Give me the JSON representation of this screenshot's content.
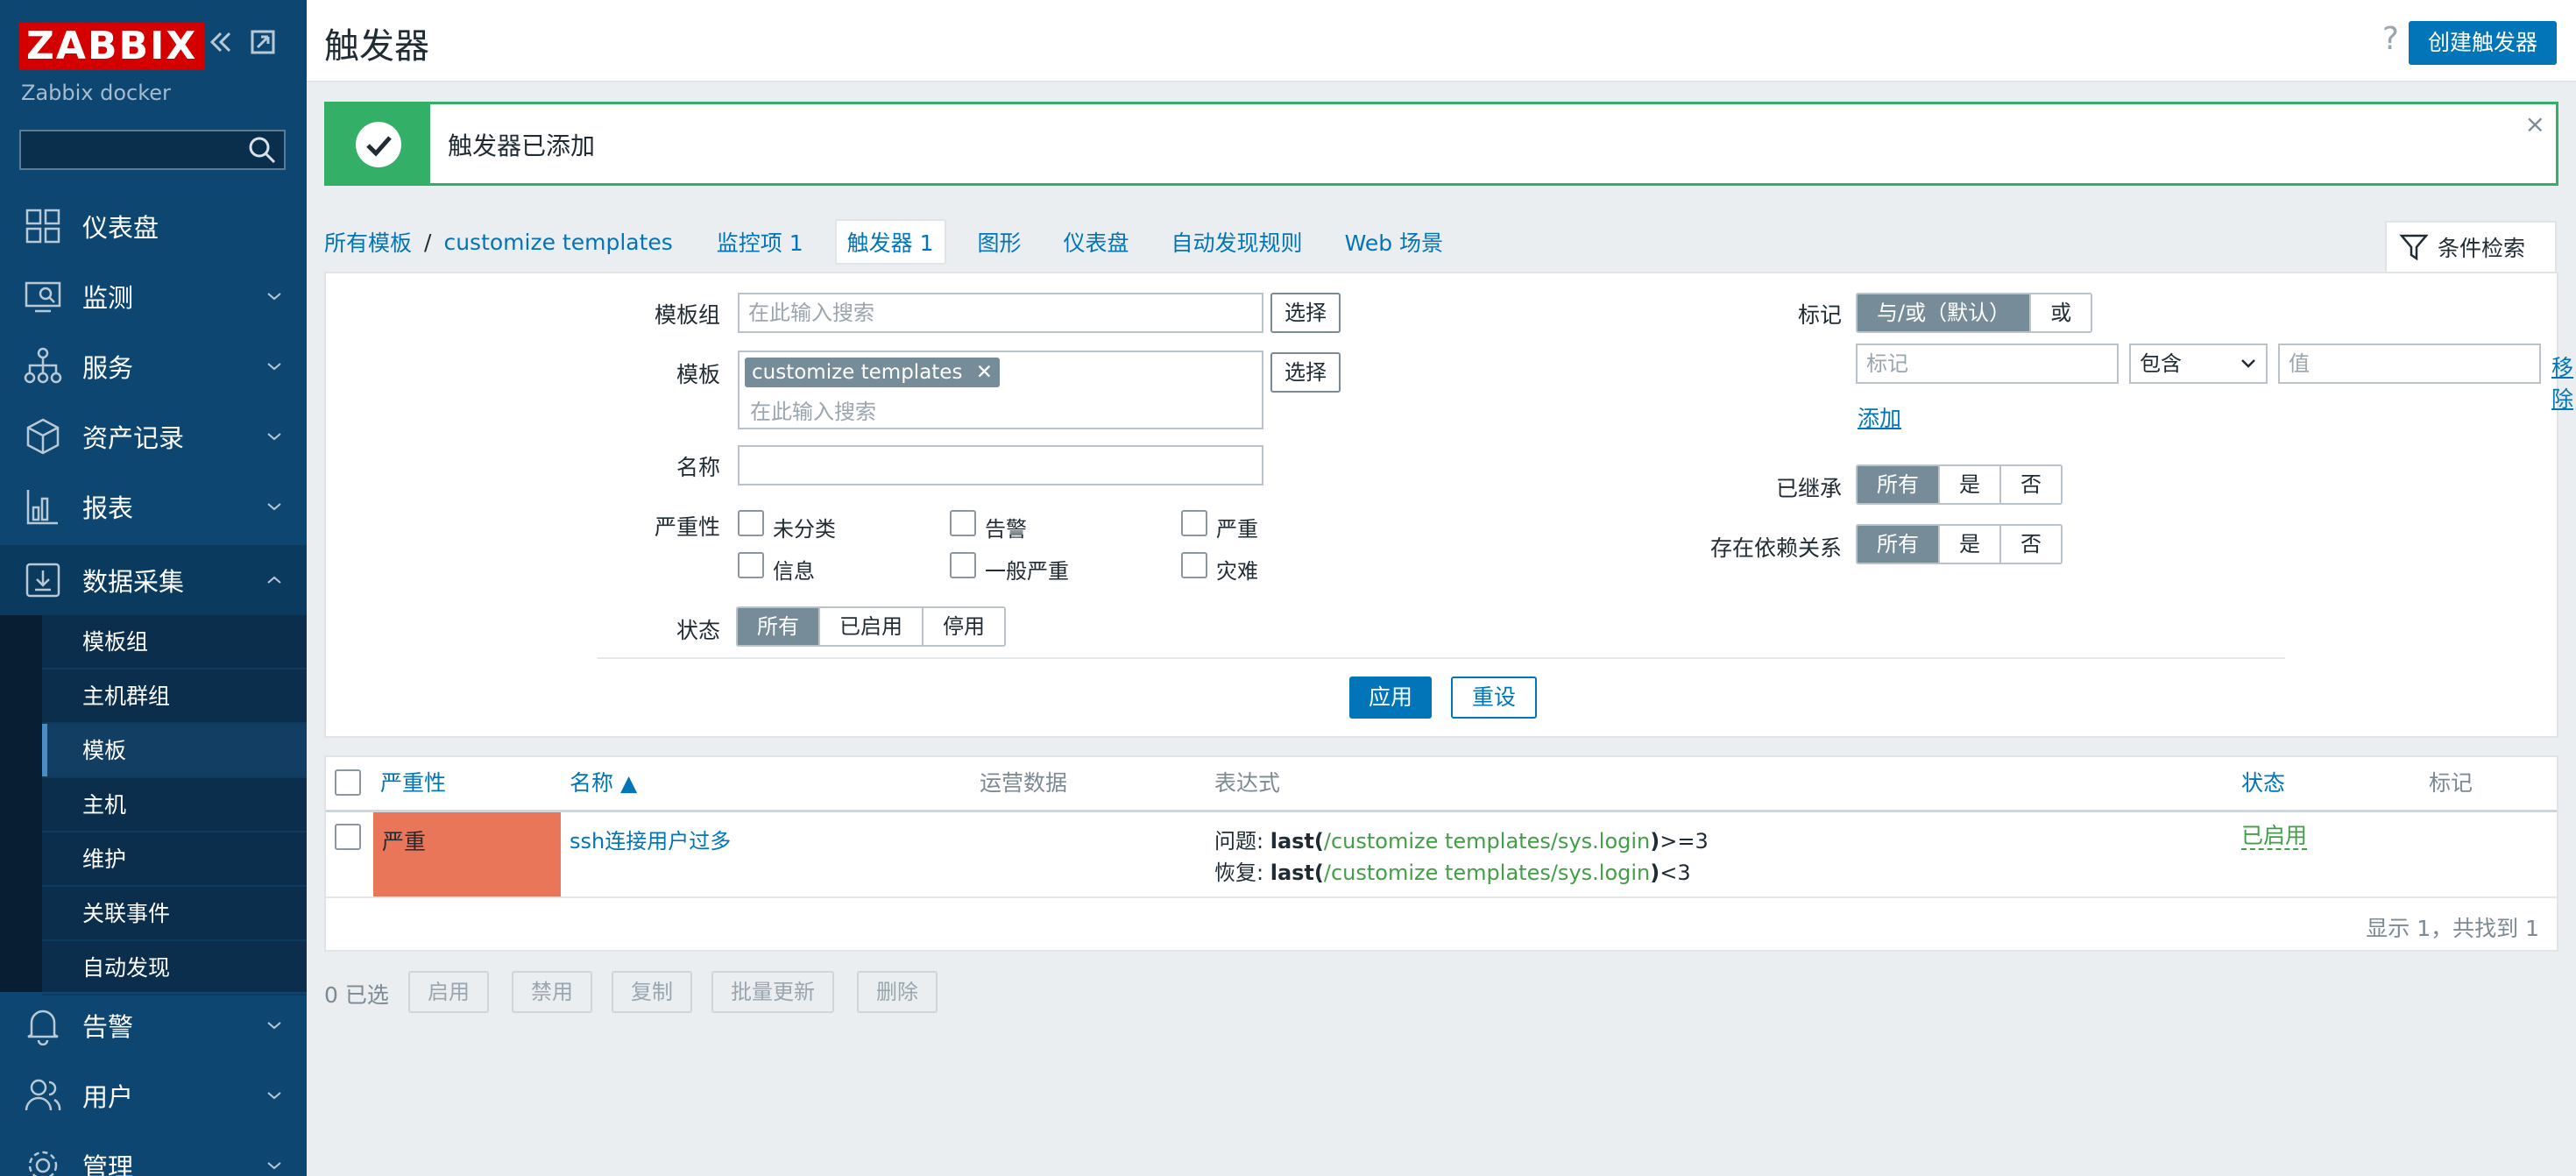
{
  "sidebar": {
    "logo": "ZABBIX",
    "collapse_icon": "double-chevron-left-icon",
    "kiosk_icon": "expand-icon",
    "server_name": "Zabbix docker",
    "search_placeholder": "",
    "menu": [
      {
        "label": "仪表盘",
        "icon": "dashboard-icon"
      },
      {
        "label": "监测",
        "icon": "monitoring-icon"
      },
      {
        "label": "服务",
        "icon": "services-icon"
      },
      {
        "label": "资产记录",
        "icon": "inventory-icon"
      },
      {
        "label": "报表",
        "icon": "reports-icon"
      },
      {
        "label": "数据采集",
        "icon": "data-collection-icon"
      },
      {
        "label": "告警",
        "icon": "bell-icon"
      },
      {
        "label": "用户",
        "icon": "users-icon"
      },
      {
        "label": "管理",
        "icon": "gear-icon"
      }
    ],
    "submenu": [
      "模板组",
      "主机群组",
      "模板",
      "主机",
      "维护",
      "关联事件",
      "自动发现"
    ],
    "active_submenu": "模板"
  },
  "header": {
    "title": "触发器",
    "help": "?",
    "create_button": "创建触发器"
  },
  "message": {
    "text": "触发器已添加",
    "close": "×"
  },
  "breadcrumb": {
    "all_templates": "所有模板",
    "sep": "/",
    "template": "customize templates"
  },
  "tabs": {
    "items": "监控项 1",
    "triggers": "触发器 1",
    "graphs": "图形",
    "dashboards": "仪表盘",
    "discovery": "自动发现规则",
    "web": "Web 场景"
  },
  "filter_tab": "条件检索",
  "filter": {
    "template_group_label": "模板组",
    "template_group_placeholder": "在此输入搜索",
    "select": "选择",
    "template_label": "模板",
    "template_chip": "customize templates",
    "chip_remove": "✕",
    "template_placeholder": "在此输入搜索",
    "name_label": "名称",
    "name_value": "",
    "severity_label": "严重性",
    "severities": [
      "未分类",
      "告警",
      "严重",
      "信息",
      "一般严重",
      "灾难"
    ],
    "state_label": "状态",
    "state_options": [
      "所有",
      "已启用",
      "停用"
    ],
    "tags_label": "标记",
    "tags_mode": [
      "与/或（默认）",
      "或"
    ],
    "tag_placeholder": "标记",
    "tag_operator": "包含",
    "tag_value_placeholder": "值",
    "remove": "移除",
    "add": "添加",
    "inherited_label": "已继承",
    "inherited_options": [
      "所有",
      "是",
      "否"
    ],
    "dependencies_label": "存在依赖关系",
    "dependencies_options": [
      "所有",
      "是",
      "否"
    ],
    "apply": "应用",
    "reset": "重设"
  },
  "table": {
    "columns": {
      "severity": "严重性",
      "name": "名称 ▲",
      "operational": "运营数据",
      "expression": "表达式",
      "status": "状态",
      "tags": "标记"
    },
    "row": {
      "severity": "严重",
      "severity_color": "#e97659",
      "name": "ssh连接用户过多",
      "problem_prefix": "问题: ",
      "func": "last",
      "item": "/customize templates/sys.login",
      "problem_suffix": ">=3",
      "recovery_prefix": "恢复: ",
      "recovery_suffix": "<3",
      "status": "已启用"
    },
    "paging": "显示 1，共找到 1"
  },
  "actions": {
    "selected": "0 已选",
    "enable": "启用",
    "disable": "禁用",
    "copy": "复制",
    "mass_update": "批量更新",
    "delete": "删除"
  },
  "colors": {
    "sidebar": "#0e4672",
    "accent": "#0275b8",
    "success": "#34af67",
    "high_severity": "#e97659"
  }
}
